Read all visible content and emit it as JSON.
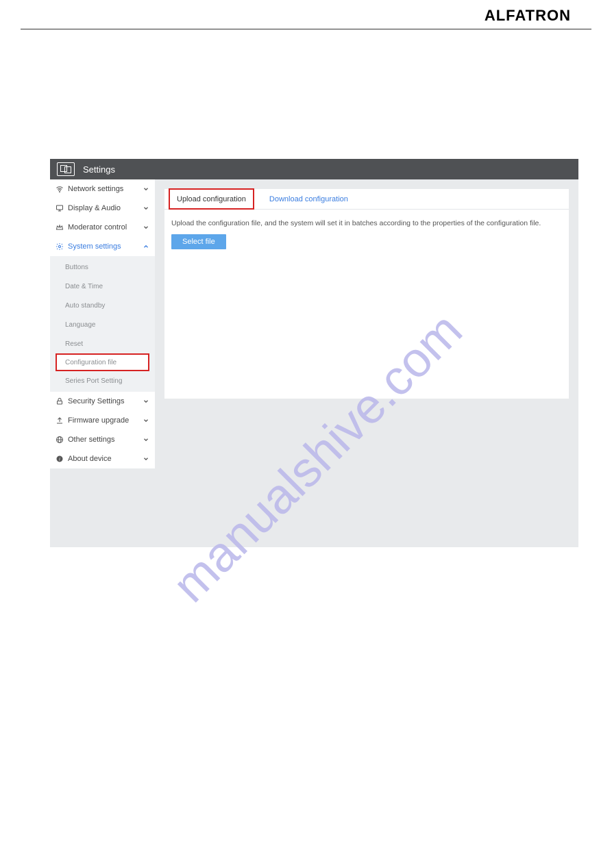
{
  "brand": "ALFATRON",
  "window_title": "Settings",
  "sidebar": {
    "items": [
      {
        "label": "Network settings"
      },
      {
        "label": "Display & Audio"
      },
      {
        "label": "Moderator control"
      },
      {
        "label": "System settings"
      },
      {
        "label": "Security Settings"
      },
      {
        "label": "Firmware upgrade"
      },
      {
        "label": "Other settings"
      },
      {
        "label": "About device"
      }
    ],
    "system_sub": [
      {
        "label": "Buttons"
      },
      {
        "label": "Date & Time"
      },
      {
        "label": "Auto standby"
      },
      {
        "label": "Language"
      },
      {
        "label": "Reset"
      },
      {
        "label": "Configuration file"
      },
      {
        "label": "Series Port Setting"
      }
    ]
  },
  "tabs": {
    "upload": "Upload configuration",
    "download": "Download configuration"
  },
  "upload": {
    "description": "Upload the configuration file, and the system will set it in batches according to the properties of the configuration file.",
    "select_label": "Select file"
  },
  "watermark_text": "manualshive.com"
}
